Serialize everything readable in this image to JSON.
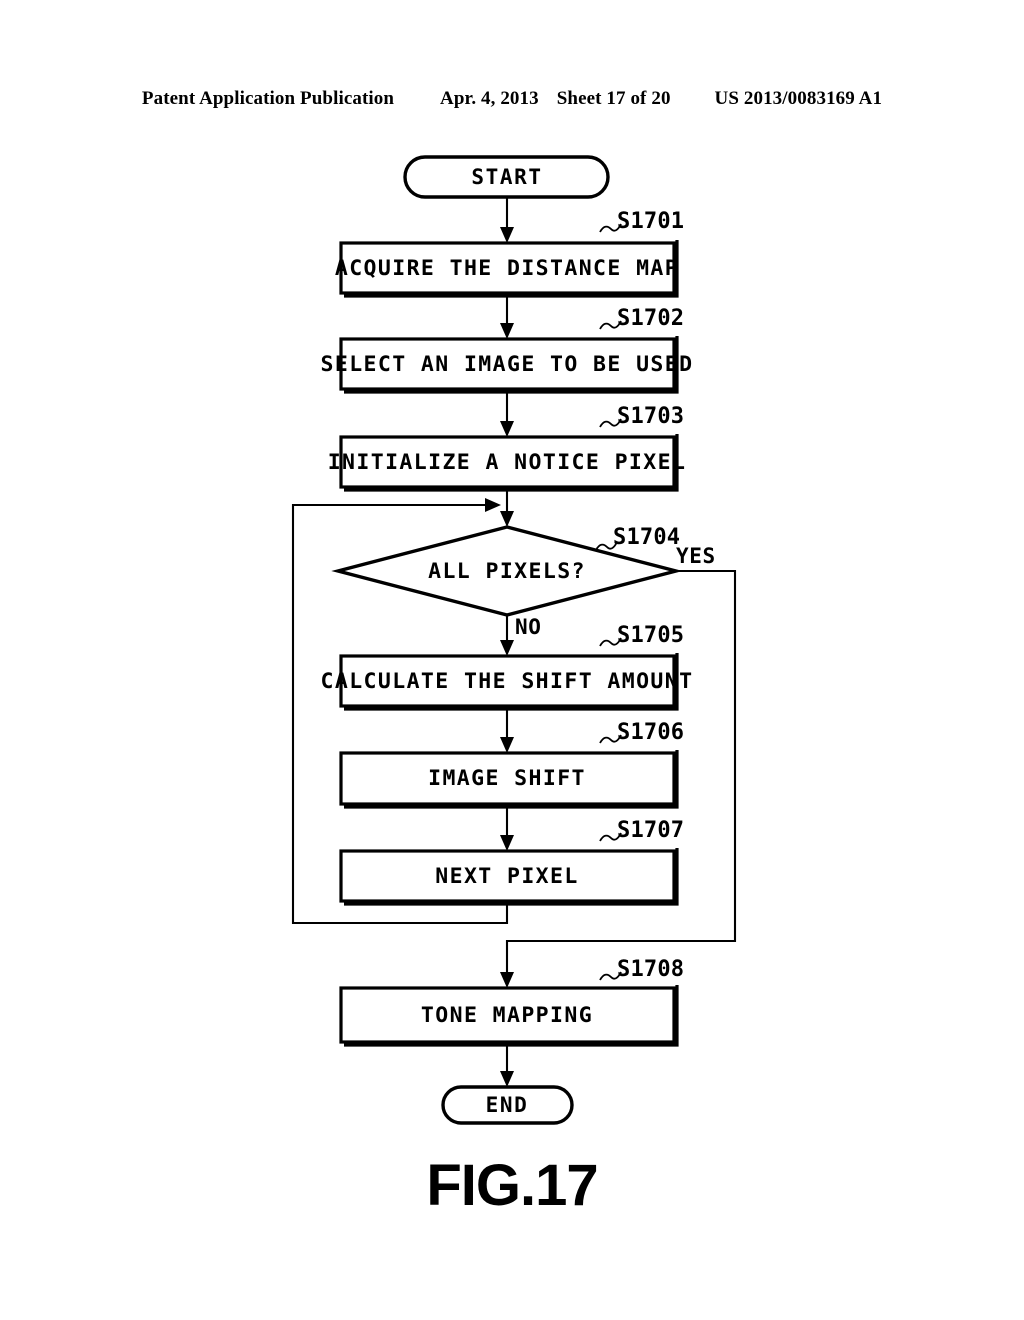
{
  "header": {
    "publication": "Patent Application Publication",
    "date": "Apr. 4, 2013",
    "sheet": "Sheet 17 of 20",
    "number": "US 2013/0083169 A1"
  },
  "figure": {
    "caption": "FIG.17"
  },
  "flowchart": {
    "start_label": "START",
    "end_label": "END",
    "branch_yes": "YES",
    "branch_no": "NO",
    "steps": [
      {
        "id": "S1701",
        "text": "ACQUIRE THE DISTANCE MAP",
        "type": "process"
      },
      {
        "id": "S1702",
        "text": "SELECT AN IMAGE TO BE USED",
        "type": "process"
      },
      {
        "id": "S1703",
        "text": "INITIALIZE A NOTICE PIXEL",
        "type": "process"
      },
      {
        "id": "S1704",
        "text": "ALL PIXELS?",
        "type": "decision"
      },
      {
        "id": "S1705",
        "text": "CALCULATE THE SHIFT AMOUNT",
        "type": "process"
      },
      {
        "id": "S1706",
        "text": "IMAGE SHIFT",
        "type": "process"
      },
      {
        "id": "S1707",
        "text": "NEXT PIXEL",
        "type": "process"
      },
      {
        "id": "S1708",
        "text": "TONE MAPPING",
        "type": "process"
      }
    ]
  },
  "colors": {
    "ink": "#000000",
    "paper": "#ffffff"
  }
}
